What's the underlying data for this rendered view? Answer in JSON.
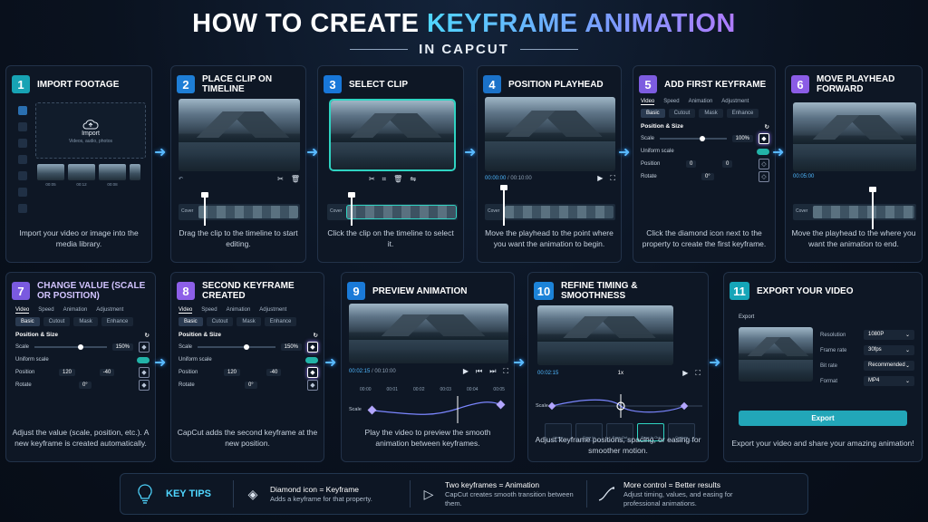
{
  "header": {
    "title_main": "HOW TO CREATE ",
    "title_accent": "KEYFRAME ANIMATION",
    "subtitle": "IN CAPCUT"
  },
  "colors": {
    "accent_cyan": "#4fd6ff",
    "accent_purple": "#b07bff",
    "selection": "#2fd3c2",
    "background": "#0a121f"
  },
  "steps": [
    {
      "num": "1",
      "title": "IMPORT FOOTAGE",
      "caption": "Import your video or image into the media library.",
      "import_label": "Import",
      "import_sub": "Videos, audio, photos",
      "thumb_labels": [
        "00:05",
        "00:12",
        "00:08",
        "00:10"
      ]
    },
    {
      "num": "2",
      "title": "PLACE CLIP ON TIMELINE",
      "caption": "Drag the clip to the timeline to start editing.",
      "cover_label": "Cover"
    },
    {
      "num": "3",
      "title": "SELECT CLIP",
      "caption": "Click the clip on the timeline to select it.",
      "cover_label": "Cover"
    },
    {
      "num": "4",
      "title": "POSITION PLAYHEAD",
      "caption": "Move the playhead to the point where you want the animation to begin.",
      "timecode": "00:00:00",
      "duration": "00:10:00",
      "cover_label": "Cover"
    },
    {
      "num": "5",
      "title": "ADD FIRST KEYFRAME",
      "caption": "Click the diamond icon next to the property to create the first keyframe.",
      "tabs": [
        "Video",
        "Speed",
        "Animation",
        "Adjustment"
      ],
      "subtabs": [
        "Basic",
        "Cutout",
        "Mask",
        "Enhance"
      ],
      "section": "Position & Size",
      "scale_label": "Scale",
      "scale_value": "100%",
      "uniform_label": "Uniform scale",
      "position_label": "Position",
      "pos_x": "0",
      "pos_y": "0",
      "rotate_label": "Rotate",
      "rotate_value": "0°"
    },
    {
      "num": "6",
      "title": "MOVE PLAYHEAD FORWARD",
      "caption": "Move the playhead to the where you want the animation to end.",
      "timecode": "00:05:00",
      "cover_label": "Cover"
    },
    {
      "num": "7",
      "title": "CHANGE VALUE (SCALE OR POSITION)",
      "caption": "Adjust the value (scale, position, etc.). A new keyframe is created automatically.",
      "tabs": [
        "Video",
        "Speed",
        "Animation",
        "Adjustment"
      ],
      "subtabs": [
        "Basic",
        "Cutout",
        "Mask",
        "Enhance"
      ],
      "section": "Position & Size",
      "scale_label": "Scale",
      "scale_value": "150%",
      "uniform_label": "Uniform scale",
      "position_label": "Position",
      "pos_x": "120",
      "pos_y": "-40",
      "rotate_label": "Rotate",
      "rotate_value": "0°"
    },
    {
      "num": "8",
      "title": "SECOND KEYFRAME CREATED",
      "caption": "CapCut adds the second keyframe at the new position.",
      "tabs": [
        "Video",
        "Speed",
        "Animation",
        "Adjustment"
      ],
      "subtabs": [
        "Basic",
        "Cutout",
        "Mask",
        "Enhance"
      ],
      "section": "Position & Size",
      "scale_label": "Scale",
      "scale_value": "150%",
      "uniform_label": "Uniform scale",
      "position_label": "Position",
      "pos_x": "120",
      "pos_y": "-40",
      "rotate_label": "Rotate",
      "rotate_value": "0°"
    },
    {
      "num": "9",
      "title": "PREVIEW ANIMATION",
      "caption": "Play the video to preview the smooth animation between keyframes.",
      "timecode": "00:02:15",
      "duration": "00:10:00",
      "scale_label": "Scale",
      "ticks": [
        "00:00",
        "00:01",
        "00:02",
        "00:03",
        "00:04",
        "00:05"
      ]
    },
    {
      "num": "10",
      "title": "REFINE TIMING & SMOOTHNESS",
      "caption": "Adjust keyframe positions, spacing, or easing for smoother motion.",
      "timecode": "00:02:15",
      "scale_label": "Scale",
      "speed_label": "1x",
      "presets": [
        "Linear",
        "Ease In",
        "Ease Out",
        "Ease In Out",
        "Custom"
      ]
    },
    {
      "num": "11",
      "title": "EXPORT YOUR VIDEO",
      "caption": "Export your video and share your amazing animation!",
      "export_heading": "Export",
      "rows": [
        {
          "label": "Resolution",
          "value": "1080P"
        },
        {
          "label": "Frame rate",
          "value": "30fps"
        },
        {
          "label": "Bit rate",
          "value": "Recommended"
        },
        {
          "label": "Format",
          "value": "MP4"
        }
      ],
      "export_button": "Export"
    }
  ],
  "tips": {
    "heading": "KEY TIPS",
    "items": [
      {
        "title": "Diamond icon = Keyframe",
        "desc": "Adds a keyframe for that property."
      },
      {
        "title": "Two keyframes = Animation",
        "desc": "CapCut creates smooth transition between them."
      },
      {
        "title": "More control = Better results",
        "desc": "Adjust timing, values, and easing for professional animations."
      }
    ]
  }
}
